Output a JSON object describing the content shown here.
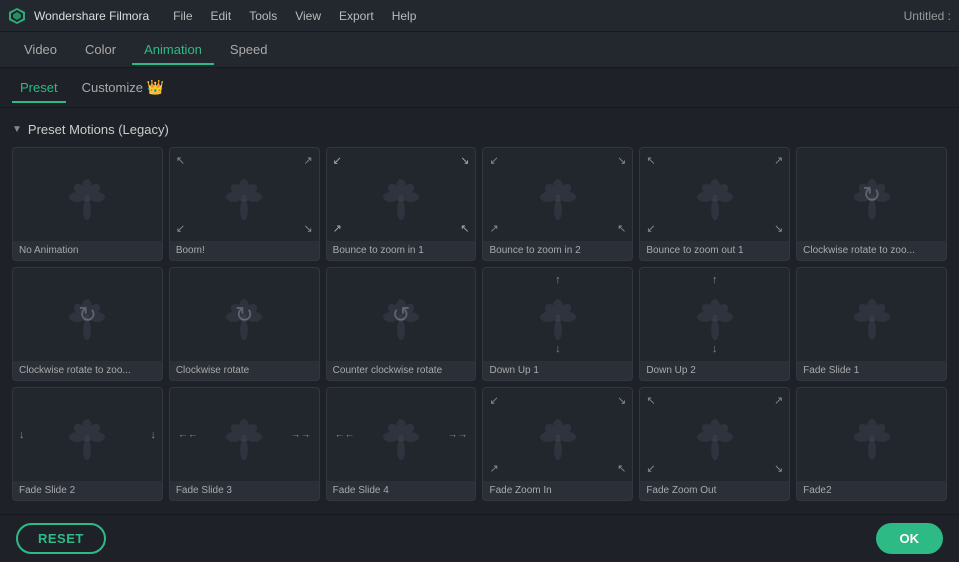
{
  "app": {
    "name": "Wondershare Filmora",
    "title": "Untitled :"
  },
  "menu": {
    "items": [
      "File",
      "Edit",
      "Tools",
      "View",
      "Export",
      "Help"
    ]
  },
  "tabs": {
    "main": [
      {
        "label": "Video",
        "active": false
      },
      {
        "label": "Color",
        "active": false
      },
      {
        "label": "Animation",
        "active": true
      },
      {
        "label": "Speed",
        "active": false
      }
    ],
    "sub": [
      {
        "label": "Preset",
        "active": true
      },
      {
        "label": "Customize",
        "active": false
      }
    ]
  },
  "section": {
    "title": "Preset Motions (Legacy)"
  },
  "presets": [
    {
      "id": "no-animation",
      "label": "No Animation",
      "arrows": []
    },
    {
      "id": "boom",
      "label": "Boom!",
      "arrows": [
        "tl",
        "tr",
        "bl",
        "br"
      ]
    },
    {
      "id": "bounce-zoom-in1",
      "label": "Bounce to zoom in 1",
      "arrows": [
        "tl-in",
        "tr-in",
        "bl-in",
        "br-in"
      ]
    },
    {
      "id": "bounce-zoom-in2",
      "label": "Bounce to zoom in 2",
      "arrows": [
        "tl-in",
        "tr-in",
        "bl-in",
        "br-in"
      ]
    },
    {
      "id": "bounce-zoom-out1",
      "label": "Bounce to zoom out 1",
      "arrows": [
        "tl-out",
        "tr-out",
        "bl-out",
        "br-out"
      ]
    },
    {
      "id": "clockwise-rotate-zoo1",
      "label": "Clockwise rotate to zoo...",
      "arrows": [
        "rotate"
      ]
    },
    {
      "id": "clockwise-rotate-zoo2",
      "label": "Clockwise rotate to zoo...",
      "arrows": [
        "rotate"
      ]
    },
    {
      "id": "clockwise-rotate",
      "label": "Clockwise rotate",
      "arrows": [
        "rotate"
      ]
    },
    {
      "id": "counter-clockwise",
      "label": "Counter clockwise rotate",
      "arrows": [
        "counter-rotate"
      ]
    },
    {
      "id": "down-up1",
      "label": "Down Up 1",
      "arrows": [
        "top",
        "bottom"
      ]
    },
    {
      "id": "down-up2",
      "label": "Down Up 2",
      "arrows": [
        "top",
        "bottom"
      ]
    },
    {
      "id": "fade-slide1",
      "label": "Fade Slide 1",
      "arrows": []
    },
    {
      "id": "fade-slide2",
      "label": "Fade Slide 2",
      "arrows": [
        "left",
        "right"
      ]
    },
    {
      "id": "fade-slide3",
      "label": "Fade Slide 3",
      "arrows": [
        "left-double",
        "right-double"
      ]
    },
    {
      "id": "fade-slide4",
      "label": "Fade Slide 4",
      "arrows": [
        "left-double",
        "right-double"
      ]
    },
    {
      "id": "fade-zoom-in",
      "label": "Fade Zoom In",
      "arrows": [
        "tl-out2",
        "tr-out2",
        "bl-out2",
        "br-out2"
      ]
    },
    {
      "id": "fade-zoom-out",
      "label": "Fade Zoom Out",
      "arrows": [
        "tl-in2",
        "tr-in2",
        "bl-in2",
        "br-in2"
      ]
    },
    {
      "id": "fade2",
      "label": "Fade2",
      "arrows": []
    }
  ],
  "buttons": {
    "reset": "RESET",
    "ok": "OK"
  }
}
